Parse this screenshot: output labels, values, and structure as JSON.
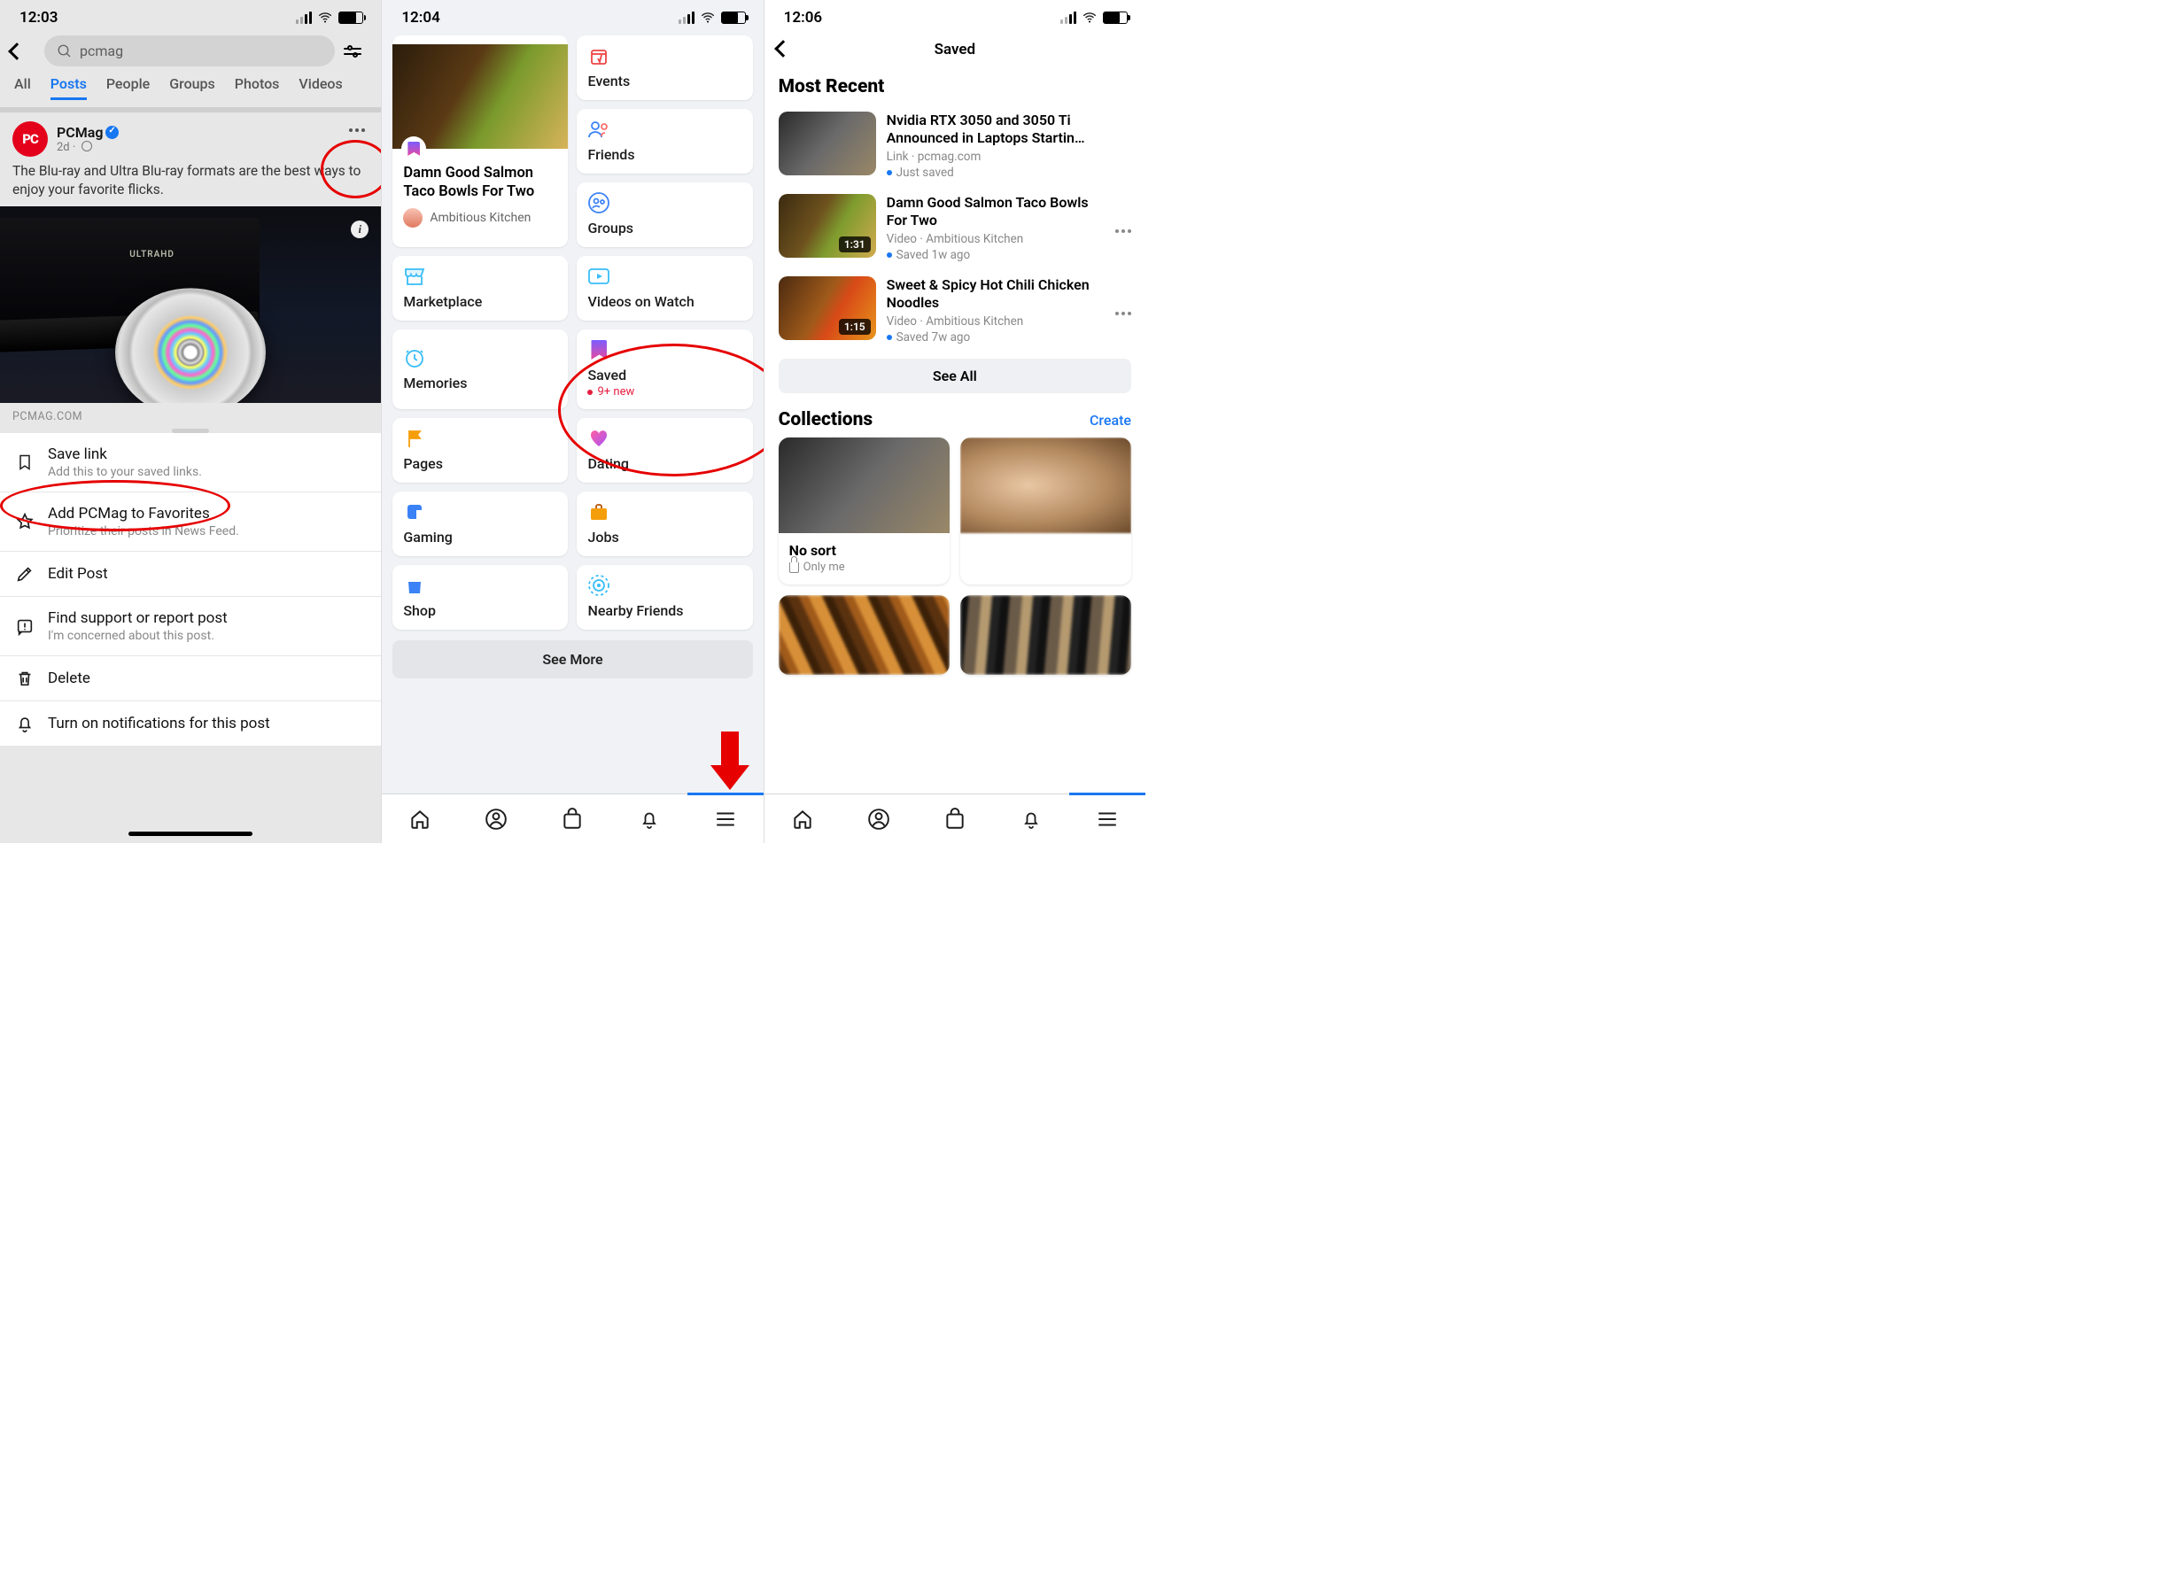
{
  "phone1": {
    "time": "12:03",
    "search_query": "pcmag",
    "tabs": [
      "All",
      "Posts",
      "People",
      "Groups",
      "Photos",
      "Videos"
    ],
    "active_tab": "Posts",
    "post": {
      "author": "PCMag",
      "age": "2d",
      "body": "The Blu-ray and Ultra Blu-ray formats are the best ways to enjoy your favorite flicks.",
      "image_badge": "ULTRAHD",
      "source": "PCMAG.COM"
    },
    "sheet": {
      "save": {
        "title": "Save link",
        "sub": "Add this to your saved links."
      },
      "fav": {
        "title": "Add PCMag to Favorites",
        "sub": "Prioritize their posts in News Feed."
      },
      "edit": {
        "title": "Edit Post"
      },
      "report": {
        "title": "Find support or report post",
        "sub": "I'm concerned about this post."
      },
      "delete": {
        "title": "Delete"
      },
      "notif": {
        "title": "Turn on notifications for this post"
      }
    }
  },
  "phone2": {
    "time": "12:04",
    "featured": {
      "title": "Damn Good Salmon Taco Bowls For Two",
      "author": "Ambitious Kitchen"
    },
    "cards": {
      "events": "Events",
      "friends": "Friends",
      "groups": "Groups",
      "marketplace": "Marketplace",
      "videos": "Videos on Watch",
      "memories": "Memories",
      "saved": "Saved",
      "saved_sub": "9+ new",
      "pages": "Pages",
      "dating": "Dating",
      "gaming": "Gaming",
      "jobs": "Jobs",
      "shop": "Shop",
      "nearby": "Nearby Friends"
    },
    "see_more": "See More"
  },
  "phone3": {
    "time": "12:06",
    "title": "Saved",
    "section_recent": "Most Recent",
    "items": [
      {
        "title": "Nvidia RTX 3050 and 3050 Ti Announced in Laptops Startin…",
        "meta": "Link · pcmag.com",
        "status": "Just saved",
        "dur": ""
      },
      {
        "title": "Damn Good Salmon Taco Bowls For Two",
        "meta": "Video · Ambitious Kitchen",
        "status": "Saved 1w ago",
        "dur": "1:31"
      },
      {
        "title": "Sweet & Spicy Hot Chili Chicken Noodles",
        "meta": "Video · Ambitious Kitchen",
        "status": "Saved 7w ago",
        "dur": "1:15"
      }
    ],
    "see_all": "See All",
    "section_collections": "Collections",
    "create": "Create",
    "collection": {
      "title": "No sort",
      "sub": "Only me"
    }
  }
}
